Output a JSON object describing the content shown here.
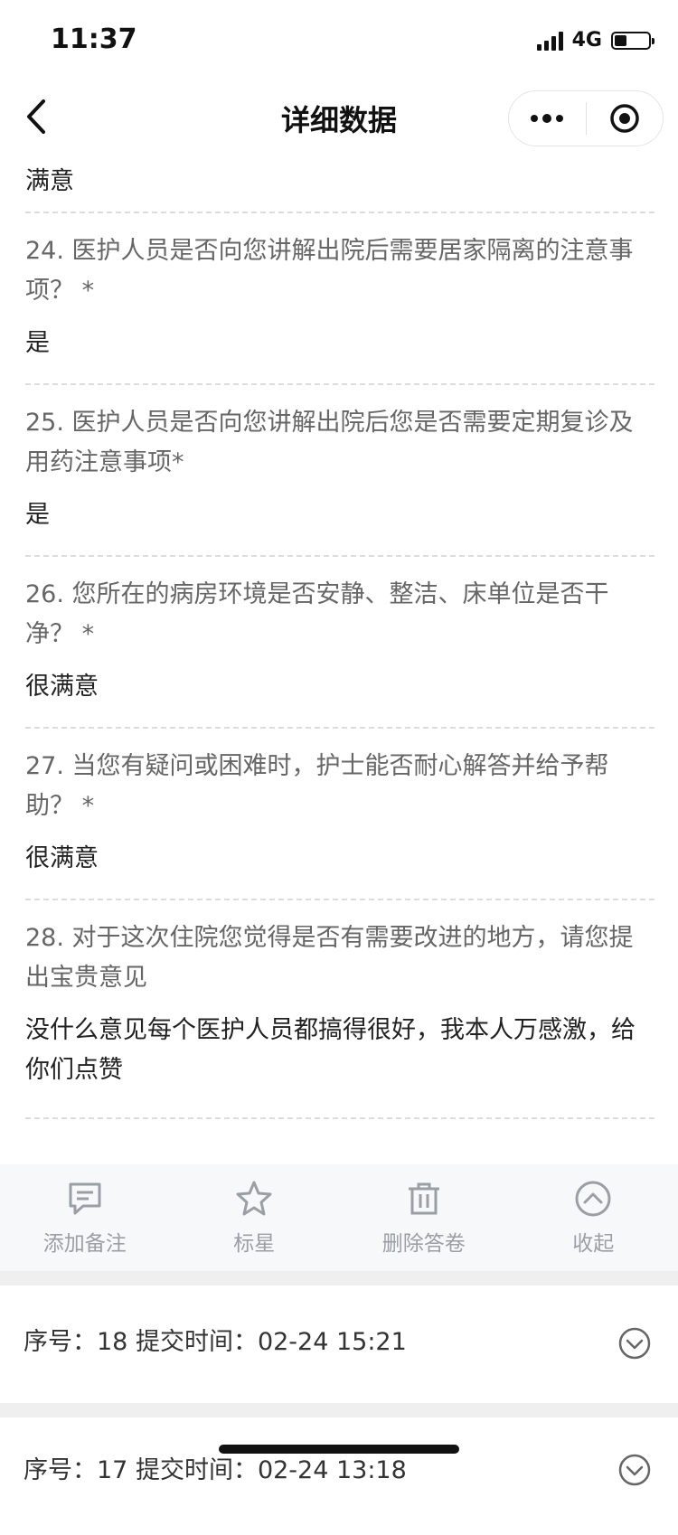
{
  "status": {
    "time": "11:37",
    "network": "4G",
    "battery_level": 0.35
  },
  "nav": {
    "back_icon": "chevron-left-icon",
    "title": "详细数据",
    "more_icon": "more-dots-icon",
    "close_icon": "target-close-icon"
  },
  "previous_answer": "满意",
  "questions": [
    {
      "question": "24. 医护人员是否向您讲解出院后需要居家隔离的注意事项？ *",
      "answer": "是"
    },
    {
      "question": "25. 医护人员是否向您讲解出院后您是否需要定期复诊及用药注意事项*",
      "answer": "是"
    },
    {
      "question": "26. 您所在的病房环境是否安静、整洁、床单位是否干净？ *",
      "answer": "很满意"
    },
    {
      "question": "27. 当您有疑问或困难时，护士能否耐心解答并给予帮助？ *",
      "answer": "很满意"
    },
    {
      "question": "28. 对于这次住院您觉得是否有需要改进的地方，请您提出宝贵意见",
      "answer": "没什么意见每个医护人员都搞得很好，我本人万感激，给你们点赞"
    }
  ],
  "actions": [
    {
      "label": "添加备注",
      "icon": "comment-icon"
    },
    {
      "label": "标星",
      "icon": "star-icon"
    },
    {
      "label": "删除答卷",
      "icon": "trash-icon"
    },
    {
      "label": "收起",
      "icon": "collapse-up-icon"
    }
  ],
  "records": [
    {
      "text": "序号：18  提交时间：02-24 15:21",
      "icon": "expand-down-icon"
    },
    {
      "text": "序号：17  提交时间：02-24 13:18",
      "icon": "expand-down-icon"
    }
  ],
  "colors": {
    "accent_gray": "#9a9ea5",
    "divider": "#dcdcdc",
    "action_bg": "#f7f8fa"
  }
}
